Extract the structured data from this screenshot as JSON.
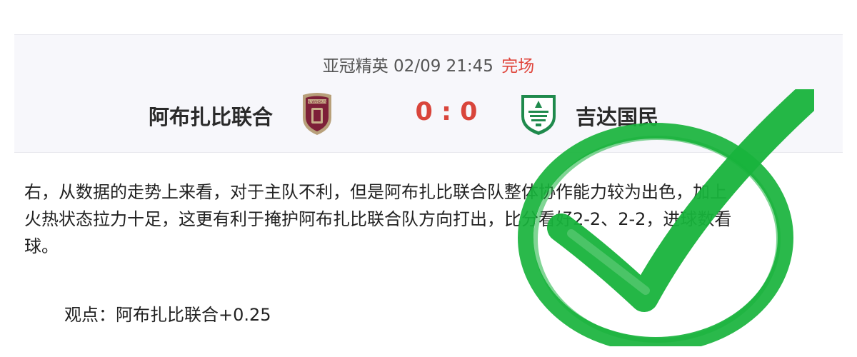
{
  "match": {
    "league": "亚冠精英",
    "datetime": "02/09 21:45",
    "status": "完场",
    "home_team": "阿布扎比联合",
    "away_team": "吉达国民",
    "score": "0 : 0",
    "home_badge_text": "AL WAHDA FC",
    "colors": {
      "status": "#e0463c",
      "score": "#d9453b",
      "card_bg": "#f7f7fb"
    }
  },
  "article": {
    "lines": [
      "右，从数据的走势上来看，对于主队不利，但是阿布扎比联合队整体协作能力较为出色，加上",
      "火热状态拉力十足，这更有利于掩护阿布扎比联合队方向打出，比分看好2-2、2-2，进球数看",
      "球。"
    ],
    "viewpoint": "观点：阿布扎比联合+0.25"
  },
  "stamp": {
    "icon": "check-stamp-icon",
    "color": "#18b33c"
  }
}
